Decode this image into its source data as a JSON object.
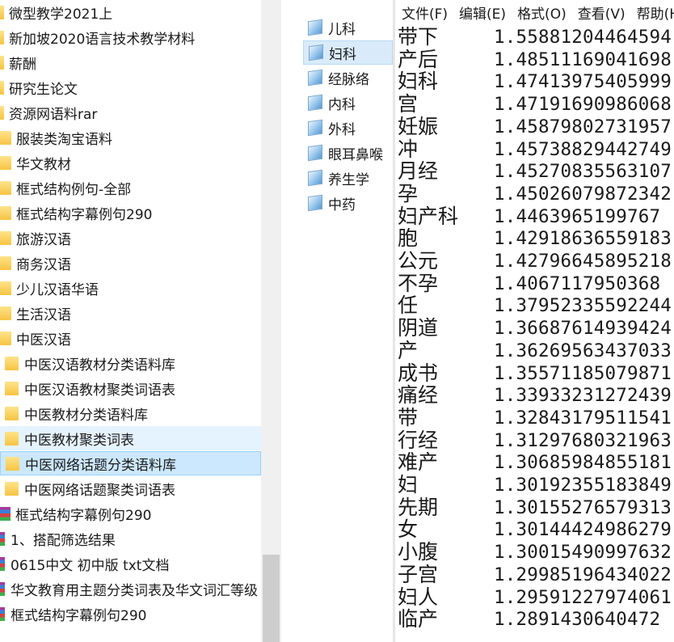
{
  "tree": {
    "items": [
      {
        "label": "微型教学2021上",
        "icon": "folder-icon"
      },
      {
        "label": "新加坡2020语言技术教学材料",
        "icon": "folder-icon"
      },
      {
        "label": "薪酬",
        "icon": "folder-icon"
      },
      {
        "label": "研究生论文",
        "icon": "folder-icon"
      },
      {
        "label": "资源网语料rar",
        "icon": "folder-icon"
      },
      {
        "label": "服装类淘宝语料",
        "icon": "folder-icon"
      },
      {
        "label": "华文教材",
        "icon": "folder-icon"
      },
      {
        "label": "框式结构例句-全部",
        "icon": "folder-icon"
      },
      {
        "label": "框式结构字幕例句290",
        "icon": "folder-icon"
      },
      {
        "label": "旅游汉语",
        "icon": "folder-icon"
      },
      {
        "label": "商务汉语",
        "icon": "folder-icon"
      },
      {
        "label": "少儿汉语华语",
        "icon": "folder-icon"
      },
      {
        "label": "生活汉语",
        "icon": "folder-icon"
      },
      {
        "label": "中医汉语",
        "icon": "folder-icon"
      },
      {
        "label": "中医汉语教材分类语料库",
        "icon": "folder-icon"
      },
      {
        "label": "中医汉语教材聚类词语表",
        "icon": "folder-icon"
      },
      {
        "label": "中医教材分类语料库",
        "icon": "folder-icon"
      },
      {
        "label": "中医教材聚类词表",
        "icon": "folder-icon"
      },
      {
        "label": "中医网络话题分类语料库",
        "icon": "folder-icon"
      },
      {
        "label": "中医网络话题聚类词语表",
        "icon": "folder-icon"
      },
      {
        "label": "框式结构字幕例句290",
        "icon": "archive-icon"
      },
      {
        "label": "1、搭配筛选结果",
        "icon": "archive-icon"
      },
      {
        "label": "0615中文 初中版 txt文档",
        "icon": "archive-icon"
      },
      {
        "label": "华文教育用主题分类词表及华文词汇等级",
        "icon": "archive-icon"
      },
      {
        "label": "框式结构字幕例句290",
        "icon": "archive-icon"
      }
    ]
  },
  "files": {
    "items": [
      {
        "label": "儿科"
      },
      {
        "label": "妇科"
      },
      {
        "label": "经脉络"
      },
      {
        "label": "内科"
      },
      {
        "label": "外科"
      },
      {
        "label": "眼耳鼻喉"
      },
      {
        "label": "养生学"
      },
      {
        "label": "中药"
      }
    ],
    "selected_label": "妇科"
  },
  "notepad": {
    "menu": {
      "file": "文件(F)",
      "edit": "编辑(E)",
      "format": "格式(O)",
      "view": "查看(V)",
      "help": "帮助(H)"
    },
    "lines": [
      {
        "word": "带下",
        "score": "1.55881204464594"
      },
      {
        "word": "产后",
        "score": "1.48511169041698"
      },
      {
        "word": "妇科",
        "score": "1.47413975405999"
      },
      {
        "word": "宫",
        "score": "1.47191690986068"
      },
      {
        "word": "妊娠",
        "score": "1.45879802731957"
      },
      {
        "word": "冲",
        "score": "1.45738829442749"
      },
      {
        "word": "月经",
        "score": "1.45270835563107"
      },
      {
        "word": "孕",
        "score": "1.45026079872342"
      },
      {
        "word": "妇产科",
        "score": "1.4463965199767"
      },
      {
        "word": "胞",
        "score": "1.42918636559183"
      },
      {
        "word": "公元",
        "score": "1.42796645895218"
      },
      {
        "word": "不孕",
        "score": "1.4067117950368"
      },
      {
        "word": "任",
        "score": "1.37952335592244"
      },
      {
        "word": "阴道",
        "score": "1.36687614939424"
      },
      {
        "word": "产",
        "score": "1.36269563437033"
      },
      {
        "word": "成书",
        "score": "1.35571185079871"
      },
      {
        "word": "痛经",
        "score": "1.33933231272439"
      },
      {
        "word": "带",
        "score": "1.32843179511541"
      },
      {
        "word": "行经",
        "score": "1.31297680321963"
      },
      {
        "word": "难产",
        "score": "1.30685984855181"
      },
      {
        "word": "妇",
        "score": "1.30192355183849"
      },
      {
        "word": "先期",
        "score": "1.30155276579313"
      },
      {
        "word": "女",
        "score": "1.30144424986279"
      },
      {
        "word": "小腹",
        "score": "1.30015490997632"
      },
      {
        "word": "子宫",
        "score": "1.29985196434022"
      },
      {
        "word": "妇人",
        "score": "1.29591227974061"
      },
      {
        "word": "临产",
        "score": "1.2891430640472"
      }
    ]
  },
  "colors": {
    "selection": "#cce8ff",
    "hover": "#e5f3ff",
    "folder": "#f6c443"
  }
}
